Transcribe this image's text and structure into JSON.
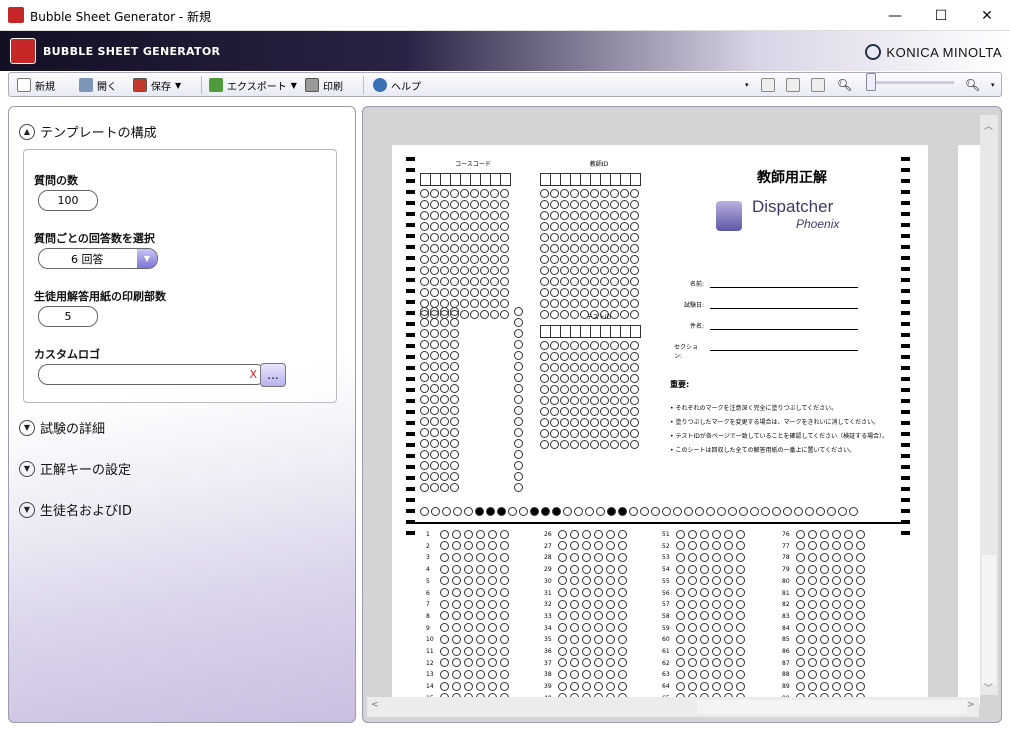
{
  "window": {
    "title": "Bubble Sheet Generator - 新規",
    "minimize": "—",
    "maximize": "☐",
    "close": "✕"
  },
  "header": {
    "app_name": "BUBBLE SHEET GENERATOR",
    "brand": "KONICA MINOLTA"
  },
  "toolbar": {
    "new_label": "新規",
    "open_label": "開く",
    "save_label": "保存",
    "export_label": "エクスポート",
    "print_label": "印刷",
    "help_label": "ヘルプ"
  },
  "left_panel": {
    "template_section": "テンプレートの構成",
    "question_count_label": "質問の数",
    "question_count_value": "100",
    "answers_per_question_label": "質問ごとの回答数を選択",
    "answers_per_question_value": "6 回答",
    "student_copies_label": "生徒用解答用紙の印刷部数",
    "student_copies_value": "5",
    "custom_logo_label": "カスタムロゴ",
    "custom_logo_value": "",
    "clear_logo": "X",
    "browse_label": "...",
    "exam_details_section": "試験の詳細",
    "answer_key_section": "正解キーの設定",
    "student_name_section": "生徒名およびID"
  },
  "sheet": {
    "course_code_label": "コースコード",
    "teacher_id_label": "教師ID",
    "test_id_label": "テストID",
    "title": "教師用正解",
    "logo_main": "Dispatcher",
    "logo_sub": "Phoenix",
    "fields": [
      "名前:",
      "試験日:",
      "件名:",
      "セクション:"
    ],
    "important_label": "重要:",
    "notes": [
      "• それぞれのマークを注意深く完全に塗りつぶしてください。",
      "• 塗りつぶしたマークを変更する場合は、マークをきれいに消してください。",
      "• テストIDが各ページで一致していることを確認してください（検証する場合）。",
      "• このシートは回収した全ての解答用紙の一番上に置いてください。"
    ],
    "question_columns": [
      {
        "start": 1,
        "count": 15
      },
      {
        "start": 26,
        "count": 15
      },
      {
        "start": 51,
        "count": 15
      },
      {
        "start": 76,
        "count": 15
      }
    ],
    "filled_timing_marks": [
      5,
      6,
      7,
      10,
      11,
      12,
      17,
      18
    ]
  },
  "colors": {
    "accent": "#7a76d6",
    "clear_x": "#e02020",
    "header_dark": "#141024"
  }
}
